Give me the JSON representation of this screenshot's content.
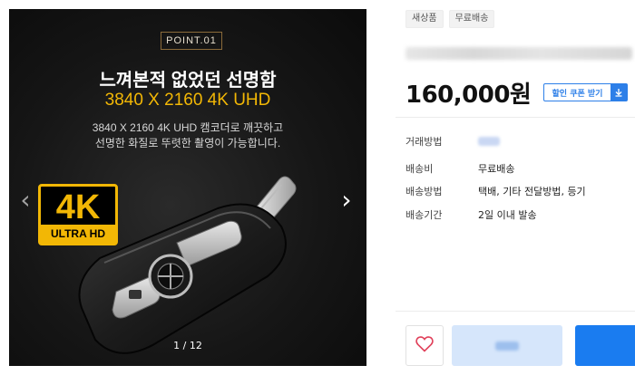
{
  "gallery": {
    "point_label": "POINT.01",
    "headline": "느껴본적 없었던 선명함",
    "subheadline": "3840 X 2160 4K UHD",
    "description_line1": "3840 X 2160 4K UHD 캠코더로 깨끗하고",
    "description_line2": "선명한 화질로 뚜렷한 촬영이 가능합니다.",
    "badge_big": "4K",
    "badge_small": "ULTRA HD",
    "counter": "1 / 12",
    "prev_icon": "chevron-left-icon",
    "next_icon": "chevron-right-icon"
  },
  "product": {
    "tags": [
      "새상품",
      "무료배송"
    ],
    "price": "160,000원",
    "coupon_label": "할인 쿠폰 받기",
    "coupon_icon": "download-icon",
    "info": [
      {
        "key": "거래방법",
        "value": ""
      },
      {
        "key": "배송비",
        "value": "무료배송"
      },
      {
        "key": "배송방법",
        "value": "택배, 기타 전달방법, 등기"
      },
      {
        "key": "배송기간",
        "value": "2일 이내 발송"
      }
    ]
  },
  "actions": {
    "wish_icon": "heart-icon"
  },
  "colors": {
    "accent": "#1a7cf0",
    "badge_gold": "#f2b705",
    "heart": "#e0405a"
  }
}
